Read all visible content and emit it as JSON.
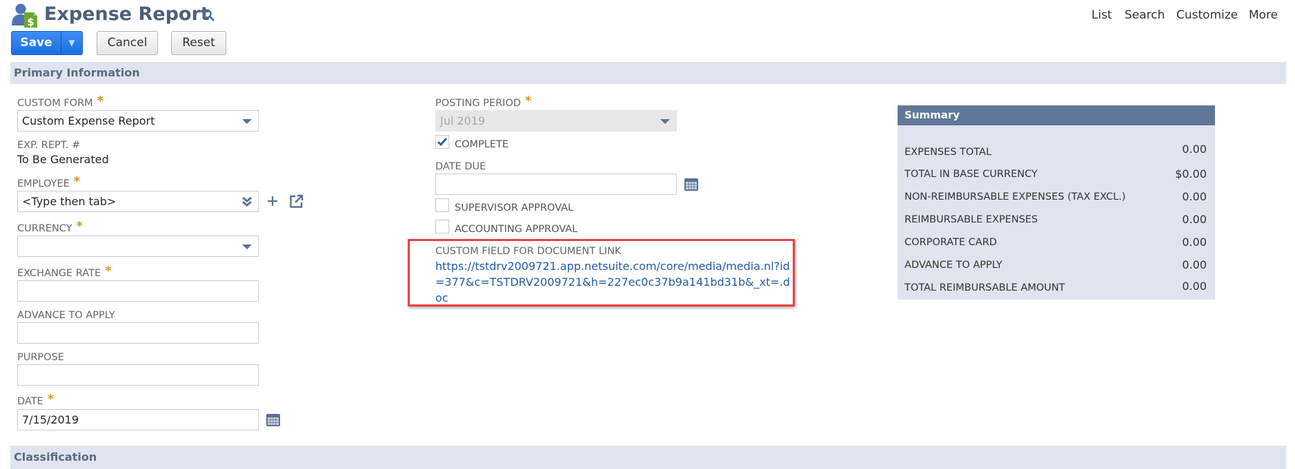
{
  "header": {
    "title": "Expense Report",
    "icon": "expense-report-icon",
    "search_icon": "search-icon",
    "nav": [
      "List",
      "Search",
      "Customize",
      "More"
    ]
  },
  "toolbar": {
    "save_label": "Save",
    "save_menu_icon": "triangle-down-icon",
    "cancel_label": "Cancel",
    "reset_label": "Reset"
  },
  "sections": {
    "primary": "Primary Information",
    "classification": "Classification"
  },
  "left_fields": {
    "custom_form": {
      "label": "Custom Form",
      "required": "*",
      "value": "Custom Expense Report"
    },
    "exp_rept": {
      "label": "Exp. Rept. #",
      "value": "To Be Generated"
    },
    "employee": {
      "label": "Employee",
      "required": "*",
      "placeholder": "<Type then tab>"
    },
    "currency": {
      "label": "Currency",
      "required": "*",
      "value": ""
    },
    "exchange_rate": {
      "label": "Exchange Rate",
      "required": "*",
      "value": ""
    },
    "advance_to_apply": {
      "label": "Advance To Apply",
      "value": ""
    },
    "purpose": {
      "label": "Purpose",
      "value": ""
    },
    "date": {
      "label": "Date",
      "required": "*",
      "value": "7/15/2019"
    }
  },
  "middle_fields": {
    "posting_period": {
      "label": "Posting Period",
      "required": "*",
      "value": "Jul 2019"
    },
    "complete": {
      "label": "Complete",
      "checked": true
    },
    "date_due": {
      "label": "Date Due",
      "value": ""
    },
    "supervisor_approval": {
      "label": "Supervisor Approval",
      "checked": false
    },
    "accounting_approval": {
      "label": "Accounting Approval",
      "checked": false
    },
    "document_link": {
      "label": "Custom Field for Document Link",
      "value": "https://tstdrv2009721.app.netsuite.com/core/media/media.nl?id=377&c=TSTDRV2009721&h=227ec0c37b9a141bd31b&_xt=.doc",
      "highlight_color": "#ee3f45"
    }
  },
  "summary": {
    "title": "Summary",
    "rows": [
      {
        "label": "Expenses Total",
        "value": "0.00"
      },
      {
        "label": "Total in Base Currency",
        "value": "$0.00"
      },
      {
        "label": "Non-Reimbursable Expenses (Tax Excl.)",
        "value": "0.00"
      },
      {
        "label": "Reimbursable Expenses",
        "value": "0.00"
      },
      {
        "label": "Corporate Card",
        "value": "0.00"
      },
      {
        "label": "Advance to Apply",
        "value": "0.00"
      },
      {
        "label": "Total Reimbursable Amount",
        "value": "0.00"
      }
    ]
  },
  "colors": {
    "accent": "#1a6ee0",
    "title": "#4d5f79",
    "band": "#dfe4ee",
    "summary_header": "#607799",
    "required": "#e0911b",
    "link": "#255ba5"
  }
}
